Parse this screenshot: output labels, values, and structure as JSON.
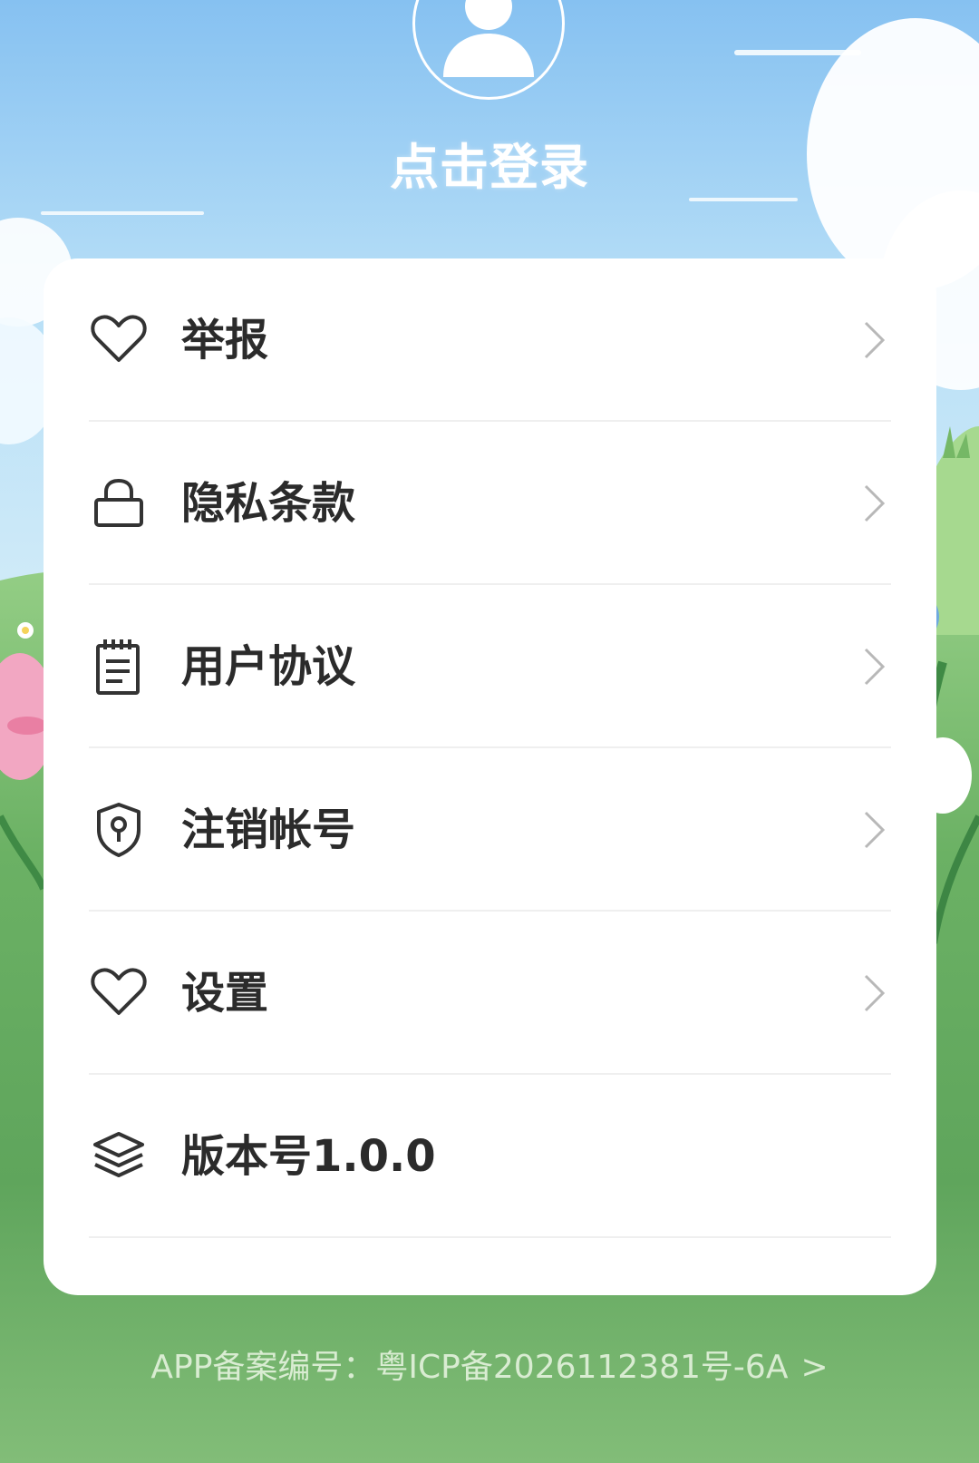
{
  "profile": {
    "login_label": "点击登录"
  },
  "menu": {
    "items": [
      {
        "label": "举报",
        "icon": "heart-icon"
      },
      {
        "label": "隐私条款",
        "icon": "lock-icon"
      },
      {
        "label": "用户协议",
        "icon": "notepad-icon"
      },
      {
        "label": "注销帐号",
        "icon": "shield-keyhole-icon"
      },
      {
        "label": "设置",
        "icon": "heart-icon"
      },
      {
        "label": "版本号1.0.0",
        "icon": "layers-icon"
      }
    ]
  },
  "footer": {
    "icp_text": "APP备案编号：粤ICP备2026112381号-6A",
    "arrow": ">"
  },
  "colors": {
    "sky_top": "#86c1f1",
    "grass": "#82bd78",
    "card_background": "#ffffff",
    "label_text": "#2b2b2b",
    "chevron": "#b8b8b8",
    "footer_text": "#d9ecd2"
  }
}
